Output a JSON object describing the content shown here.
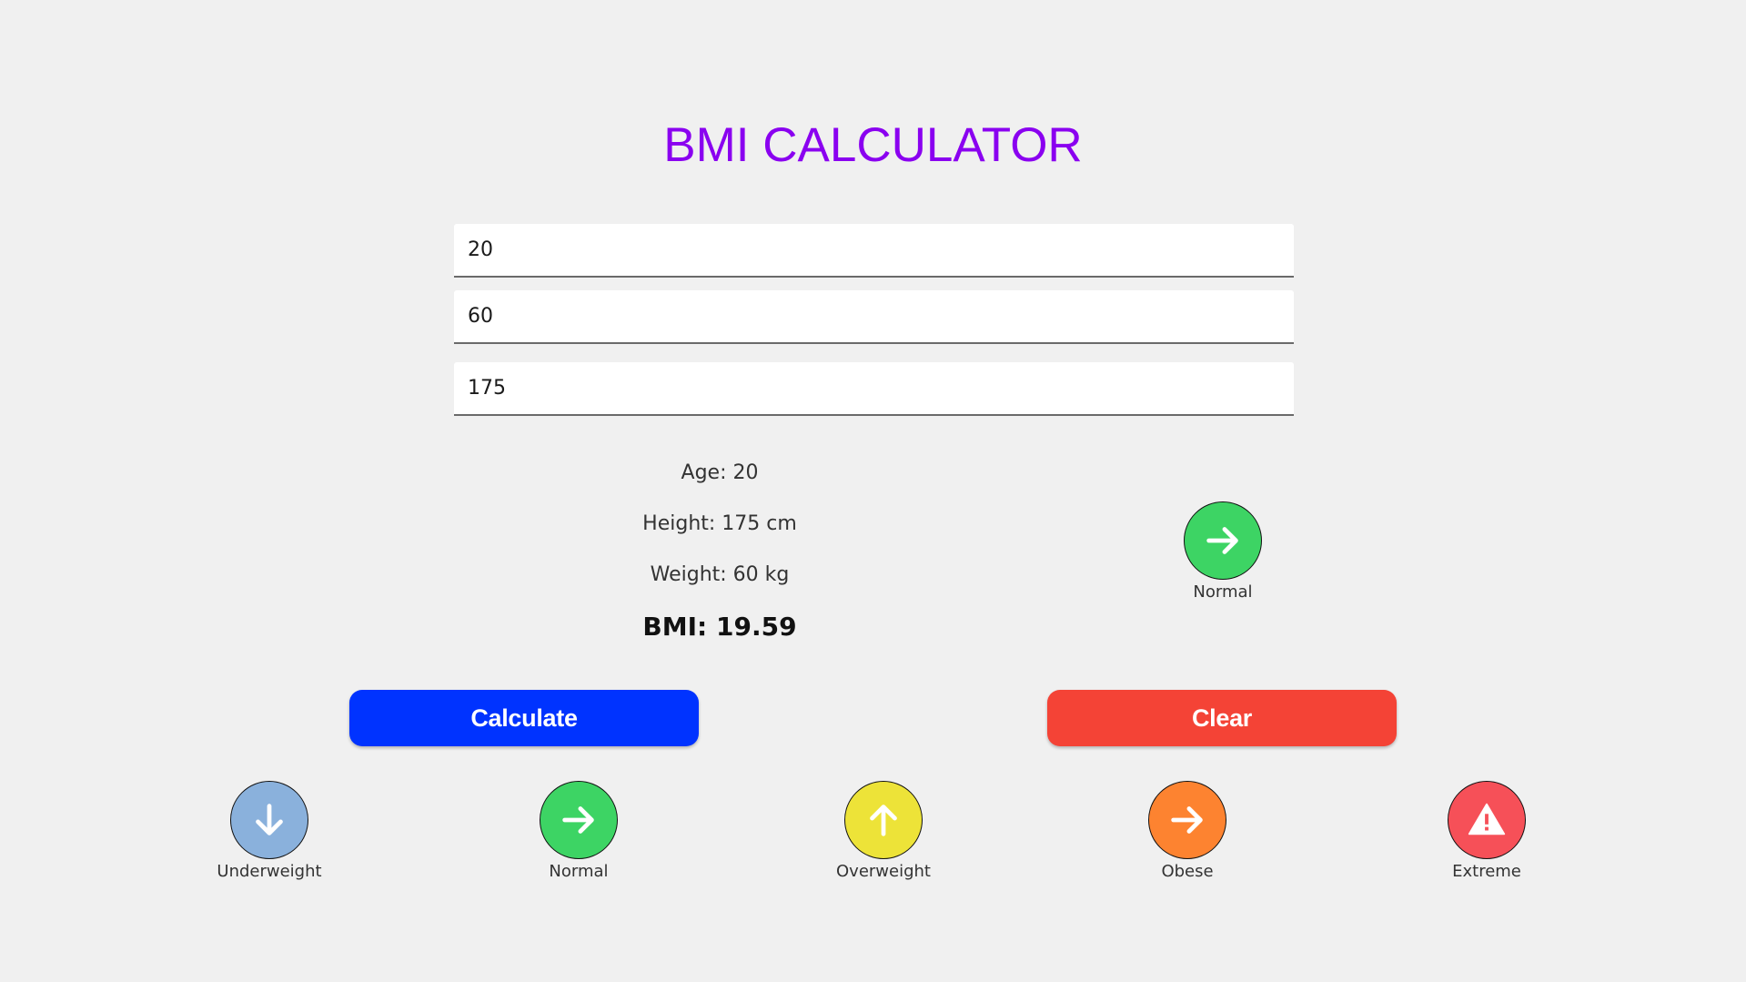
{
  "app": {
    "title": "BMI CALCULATOR"
  },
  "inputs": {
    "age": "20",
    "weight": "60",
    "height": "175"
  },
  "results": {
    "age": "Age: 20",
    "height": "Height: 175 cm",
    "weight": "Weight: 60 kg",
    "bmi": "BMI: 19.59",
    "status_label": "Normal",
    "status_icon": "arrow-right-icon",
    "status_color": "#3dd464"
  },
  "buttons": {
    "calculate": "Calculate",
    "clear": "Clear",
    "calculate_color": "#0033ff",
    "clear_color": "#f44336"
  },
  "legend": [
    {
      "label": "Underweight",
      "icon": "arrow-down-icon",
      "color": "#8ab1dc"
    },
    {
      "label": "Normal",
      "icon": "arrow-right-icon",
      "color": "#3dd464"
    },
    {
      "label": "Overweight",
      "icon": "arrow-up-icon",
      "color": "#ede338"
    },
    {
      "label": "Obese",
      "icon": "arrow-right-icon",
      "color": "#fd8330"
    },
    {
      "label": "Extreme",
      "icon": "warning-icon",
      "color": "#f65058"
    }
  ]
}
